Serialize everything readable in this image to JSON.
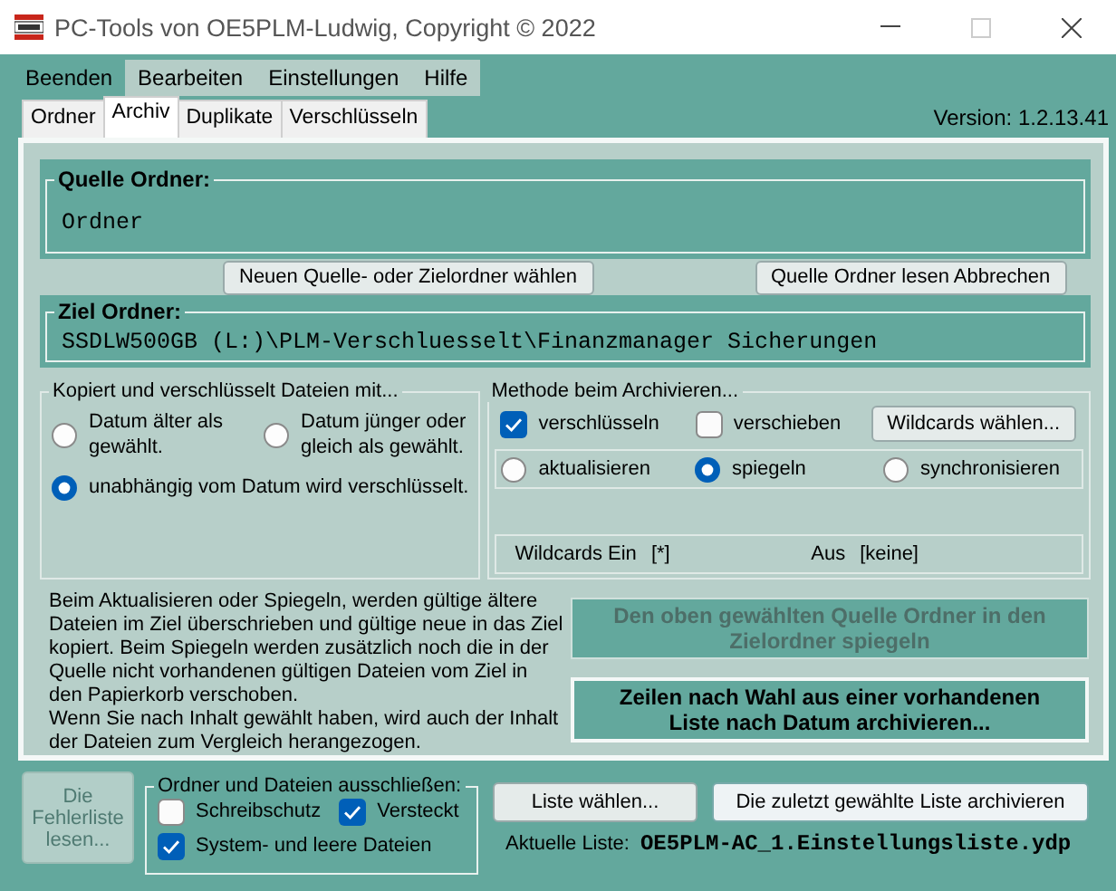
{
  "window": {
    "title": "PC-Tools von OE5PLM-Ludwig, Copyright ©  2022"
  },
  "menu": [
    {
      "label": "Beenden",
      "selected": true
    },
    {
      "label": "Bearbeiten",
      "selected": false
    },
    {
      "label": "Einstellungen",
      "selected": false
    },
    {
      "label": "Hilfe",
      "selected": false
    }
  ],
  "tabs": [
    {
      "label": "Ordner",
      "selected": false
    },
    {
      "label": "Archiv",
      "selected": true
    },
    {
      "label": "Duplikate",
      "selected": false
    },
    {
      "label": "Verschlüsseln",
      "selected": false
    }
  ],
  "version": "Version: 1.2.13.41",
  "source": {
    "legend": "Quelle Ordner:",
    "value": "Ordner"
  },
  "top_buttons": [
    "Neuen Quelle- oder Zielordner wählen",
    "Quelle Ordner lesen Abbrechen"
  ],
  "target": {
    "legend": "Ziel Ordner:",
    "value": "SSDLW500GB (L:)\\PLM-Verschluesselt\\Finanzmanager Sicherungen"
  },
  "date_group": {
    "legend": "Kopiert und verschlüsselt Dateien mit...",
    "options": [
      {
        "label": "Datum älter als gewählt.",
        "selected": false
      },
      {
        "label": "Datum jünger oder gleich als gewählt.",
        "selected": false
      },
      {
        "label": "unabhängig vom Datum wird verschlüsselt.",
        "selected": true
      }
    ]
  },
  "method_group": {
    "legend": "Methode beim Archivieren...",
    "checks": [
      {
        "label": "verschlüsseln",
        "checked": true
      },
      {
        "label": "verschieben",
        "checked": false
      }
    ],
    "wildcards_button": "Wildcards wählen...",
    "modes": [
      {
        "label": "aktualisieren",
        "selected": false
      },
      {
        "label": "spiegeln",
        "selected": true
      },
      {
        "label": "synchronisieren",
        "selected": false
      }
    ],
    "wildcards_on_label": "Wildcards Ein",
    "wildcards_on": "[*]",
    "wildcards_off_label": "Aus",
    "wildcards_off": "[keine]"
  },
  "info_text": "Beim Aktualisieren oder Spiegeln, werden gültige ältere Dateien im Ziel überschrieben und gültige neue in das Ziel kopiert. Beim Spiegeln werden zusätzlich noch die in der Quelle nicht vorhandenen gültigen Dateien vom Ziel in den Papierkorb verschoben.\nWenn Sie nach Inhalt gewählt haben, wird auch der Inhalt der Dateien zum Vergleich herangezogen.",
  "mirror_button": {
    "label": "Den oben gewählten Quelle Ordner in den Zielordner spiegeln",
    "disabled": true
  },
  "list_archive_button": {
    "label": "Zeilen nach Wahl aus einer vorhandenen Liste nach Datum archivieren...",
    "disabled": false
  },
  "error_list_button": {
    "label": "Die Fehlerliste lesen...",
    "disabled": true
  },
  "exclude_group": {
    "legend": "Ordner und Dateien ausschließen:",
    "checks": [
      {
        "label": "Schreibschutz",
        "checked": false
      },
      {
        "label": "Versteckt",
        "checked": true
      },
      {
        "label": "System- und leere Dateien",
        "checked": true
      }
    ]
  },
  "choose_list_button": "Liste wählen...",
  "archive_last_button": "Die zuletzt gewählte Liste archivieren",
  "current_list_label": "Aktuelle Liste:",
  "current_list": "OE5PLM-AC_1.Einstellungsliste.ydp"
}
